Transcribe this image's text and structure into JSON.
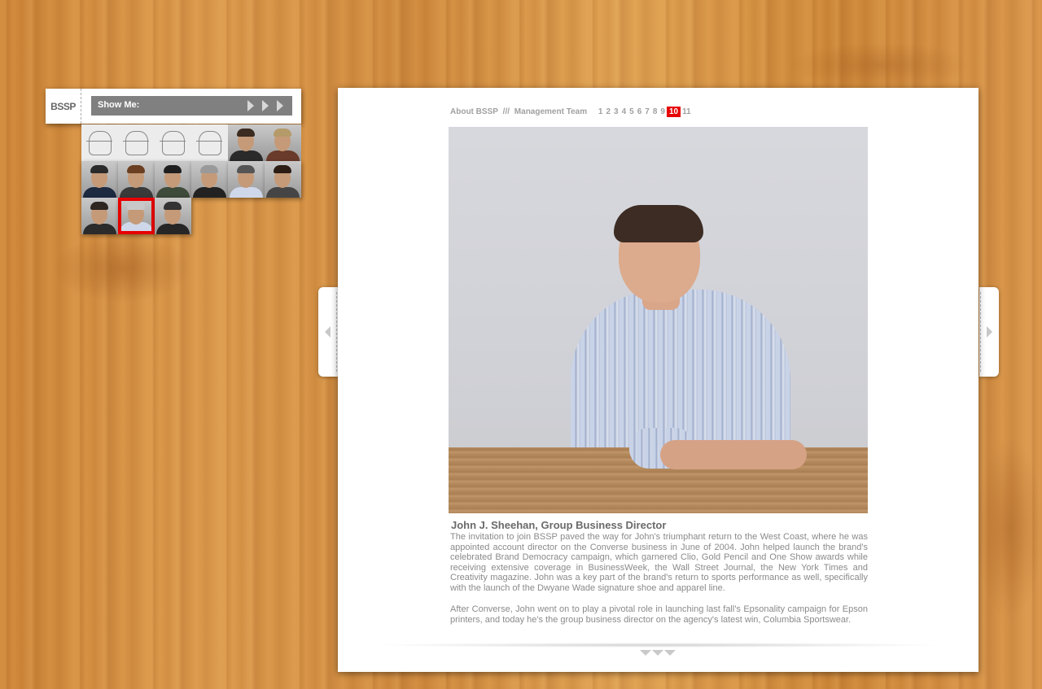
{
  "nav": {
    "logo": "BSSP",
    "show_me_label": "Show Me:"
  },
  "thumbnails": [
    {
      "kind": "sketch",
      "selected": false
    },
    {
      "kind": "sketch",
      "selected": false
    },
    {
      "kind": "sketch",
      "selected": false
    },
    {
      "kind": "sketch",
      "selected": false
    },
    {
      "kind": "photo",
      "selected": false
    },
    {
      "kind": "photo",
      "selected": false
    },
    {
      "kind": "photo",
      "selected": false
    },
    {
      "kind": "photo",
      "selected": false
    },
    {
      "kind": "photo",
      "selected": false
    },
    {
      "kind": "photo",
      "selected": false
    },
    {
      "kind": "photo",
      "selected": false
    },
    {
      "kind": "photo",
      "selected": false
    },
    {
      "kind": "photo",
      "selected": false
    },
    {
      "kind": "photo",
      "selected": true
    },
    {
      "kind": "photo",
      "selected": false
    }
  ],
  "breadcrumb": {
    "section": "About BSSP",
    "separator": "///",
    "subsection": "Management Team",
    "pages": [
      "1",
      "2",
      "3",
      "4",
      "5",
      "6",
      "7",
      "8",
      "9",
      "10",
      "11"
    ],
    "current_page": "10"
  },
  "profile": {
    "name_title": "John J. Sheehan, Group Business Director",
    "bio_paragraph_1": "The invitation to join BSSP paved the way for John's triumphant return to the West Coast, where he was appointed account director on the Converse business in June of 2004. John helped launch the brand's celebrated Brand Democracy campaign, which garnered Clio, Gold Pencil and One Show awards while receiving extensive coverage in BusinessWeek, the Wall Street Journal, the New York Times and Creativity magazine. John was a key part of the brand's return to sports performance as well, specifically with the launch of the Dwyane Wade signature shoe and apparel line.",
    "bio_paragraph_2": "After Converse, John went on to play a pivotal role in launching last fall's Epsonality campaign for Epson printers, and today he's the group business director on the agency's latest win, Columbia Sportswear."
  },
  "colors": {
    "accent": "#e60000",
    "bar": "#808080",
    "text": "#8a8a8a"
  },
  "icons": {
    "show_me_arrows": "play-arrow-icon",
    "prev": "chevron-left-icon",
    "next": "chevron-right-icon",
    "scroll": "chevron-down-icon"
  }
}
